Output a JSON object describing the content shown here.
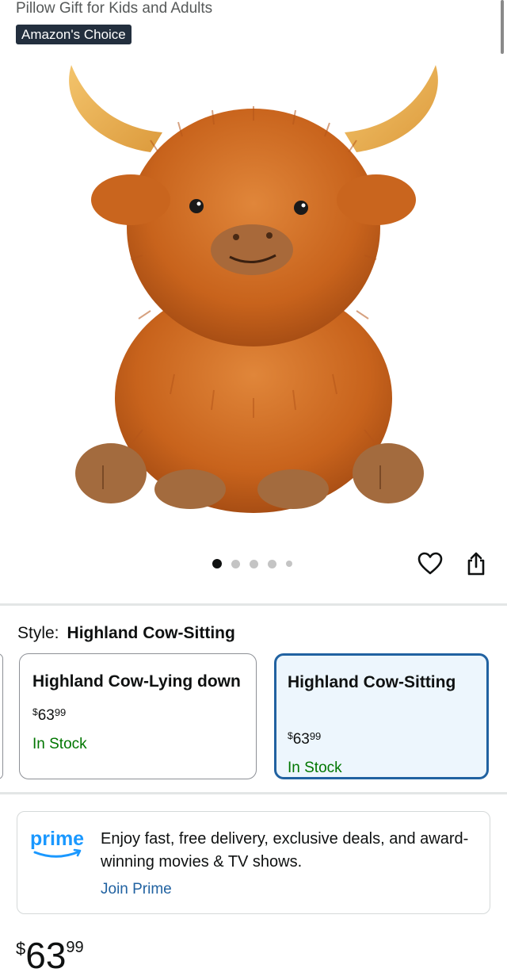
{
  "header": {
    "title_line": "Pillow Gift for Kids and Adults",
    "badge": "Amazon's Choice"
  },
  "gallery": {
    "image_count": 5,
    "active_index": 0,
    "image_icon": "highland-cow-plush-image"
  },
  "actions": {
    "heart_icon": "heart-icon",
    "share_icon": "share-icon"
  },
  "style_selector": {
    "label": "Style:",
    "selected": "Highland Cow-Sitting",
    "options": [
      {
        "name": "Highland Cow-Lying down",
        "price_symbol": "$",
        "price_whole": "63",
        "price_fraction": "99",
        "availability": "In Stock"
      },
      {
        "name": "Highland Cow-Sitting",
        "price_symbol": "$",
        "price_whole": "63",
        "price_fraction": "99",
        "availability": "In Stock"
      }
    ]
  },
  "prime": {
    "logo_text": "prime",
    "message": "Enjoy fast, free delivery, exclusive deals, and award-winning movies & TV shows.",
    "link": "Join Prime"
  },
  "price": {
    "symbol": "$",
    "whole": "63",
    "fraction": "99"
  },
  "colors": {
    "badge_bg": "#232f3e",
    "selected_border": "#2162a1",
    "selected_bg": "#edf6fd",
    "in_stock": "#007600",
    "link": "#2162a1",
    "prime_blue": "#1a98ff"
  }
}
